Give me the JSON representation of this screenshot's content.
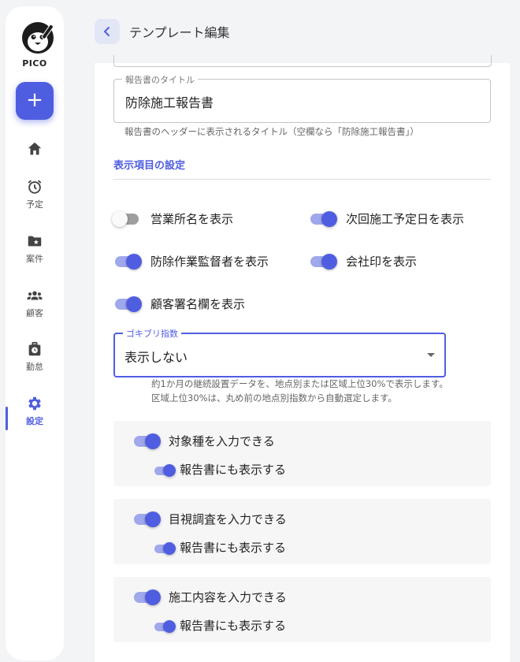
{
  "app": {
    "logo_text": "PICO"
  },
  "sidebar": {
    "add_label": "+",
    "items": [
      {
        "label": "",
        "icon": "home-icon"
      },
      {
        "label": "予定",
        "icon": "alarm-clock-icon"
      },
      {
        "label": "案件",
        "icon": "folder-star-icon"
      },
      {
        "label": "顧客",
        "icon": "people-icon"
      },
      {
        "label": "勤怠",
        "icon": "briefcase-clock-icon"
      },
      {
        "label": "設定",
        "icon": "gear-icon"
      }
    ]
  },
  "header": {
    "title": "テンプレート編集"
  },
  "form": {
    "report_title": {
      "label": "報告書のタイトル",
      "value": "防除施工報告書",
      "helper": "報告書のヘッダーに表示されるタイトル（空欄なら「防除施工報告書」）"
    },
    "section_title": "表示項目の設定",
    "toggles": [
      {
        "label": "営業所名を表示",
        "on": false
      },
      {
        "label": "次回施工予定日を表示",
        "on": true
      },
      {
        "label": "防除作業監督者を表示",
        "on": true
      },
      {
        "label": "会社印を表示",
        "on": true
      },
      {
        "label": "顧客署名欄を表示",
        "on": true
      }
    ],
    "cockroach_index": {
      "label": "ゴキブリ指数",
      "value": "表示しない",
      "helper_line1": "約1か月の継続設置データを、地点別または区域上位30%で表示します。",
      "helper_line2": "区域上位30%は、丸め前の地点別指数から自動選定します。"
    },
    "input_groups": [
      {
        "main_label": "対象種を入力できる",
        "sub_label": "報告書にも表示する"
      },
      {
        "main_label": "目視調査を入力できる",
        "sub_label": "報告書にも表示する"
      },
      {
        "main_label": "施工内容を入力できる",
        "sub_label": "報告書にも表示する"
      }
    ]
  },
  "colors": {
    "accent": "#4f5ee0",
    "accent_light": "#a0a8ec",
    "background": "#f3f4f6"
  }
}
